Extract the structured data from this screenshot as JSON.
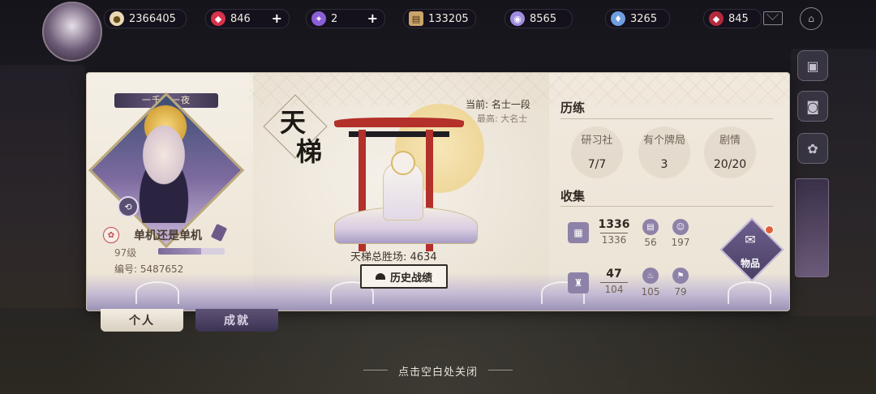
{
  "top_bar": {
    "resources": [
      {
        "icon": "coin-icon",
        "value": "2366405",
        "color": "#e9d8b4",
        "addable": false
      },
      {
        "icon": "red-jade-icon",
        "value": "846",
        "color": "#d8324a",
        "addable": true
      },
      {
        "icon": "purple-ticket-icon",
        "value": "2",
        "color": "#8a5fd6",
        "addable": true
      },
      {
        "icon": "scroll-icon",
        "value": "133205",
        "color": "#caa46a",
        "addable": false
      },
      {
        "icon": "purple-orb-icon",
        "value": "8565",
        "color": "#a18de0",
        "addable": false
      },
      {
        "icon": "blue-flame-icon",
        "value": "3265",
        "color": "#6e9fe0",
        "addable": false
      },
      {
        "icon": "red-crystal-icon",
        "value": "845",
        "color": "#b42a3c",
        "addable": false
      }
    ]
  },
  "profile": {
    "title_ribbon": "一千零一夜",
    "name": "单机还是单机",
    "level": "97级",
    "level_progress": 0.65,
    "id_label": "编号: 5487652"
  },
  "tabs": [
    {
      "label": "个人",
      "active": true
    },
    {
      "label": "成就",
      "active": false
    }
  ],
  "ladder": {
    "logo_chars": [
      "天",
      "梯"
    ],
    "current_rank": "当前: 名士一段",
    "best_rank": "最高: 大名士",
    "total_wins": "天梯总胜场: 4634",
    "history_button": "历史战绩"
  },
  "training": {
    "title": "历练",
    "items": [
      {
        "label": "研习社",
        "value": "7/7"
      },
      {
        "label": "有个牌局",
        "value": "3"
      },
      {
        "label": "剧情",
        "value": "20/20"
      }
    ]
  },
  "collection": {
    "title": "收集",
    "cards": {
      "owned": "1336",
      "total": "1336"
    },
    "card_extras": [
      {
        "icon": "card-stack-icon",
        "value": "56"
      },
      {
        "icon": "sticker-icon",
        "value": "197"
      }
    ],
    "outfits": {
      "owned": "47",
      "total": "104"
    },
    "outfit_extras": [
      {
        "icon": "flame-icon",
        "value": "105"
      },
      {
        "icon": "stamp-icon",
        "value": "79"
      }
    ],
    "items_button": "物品"
  },
  "close_hint": "点击空白处关闭"
}
